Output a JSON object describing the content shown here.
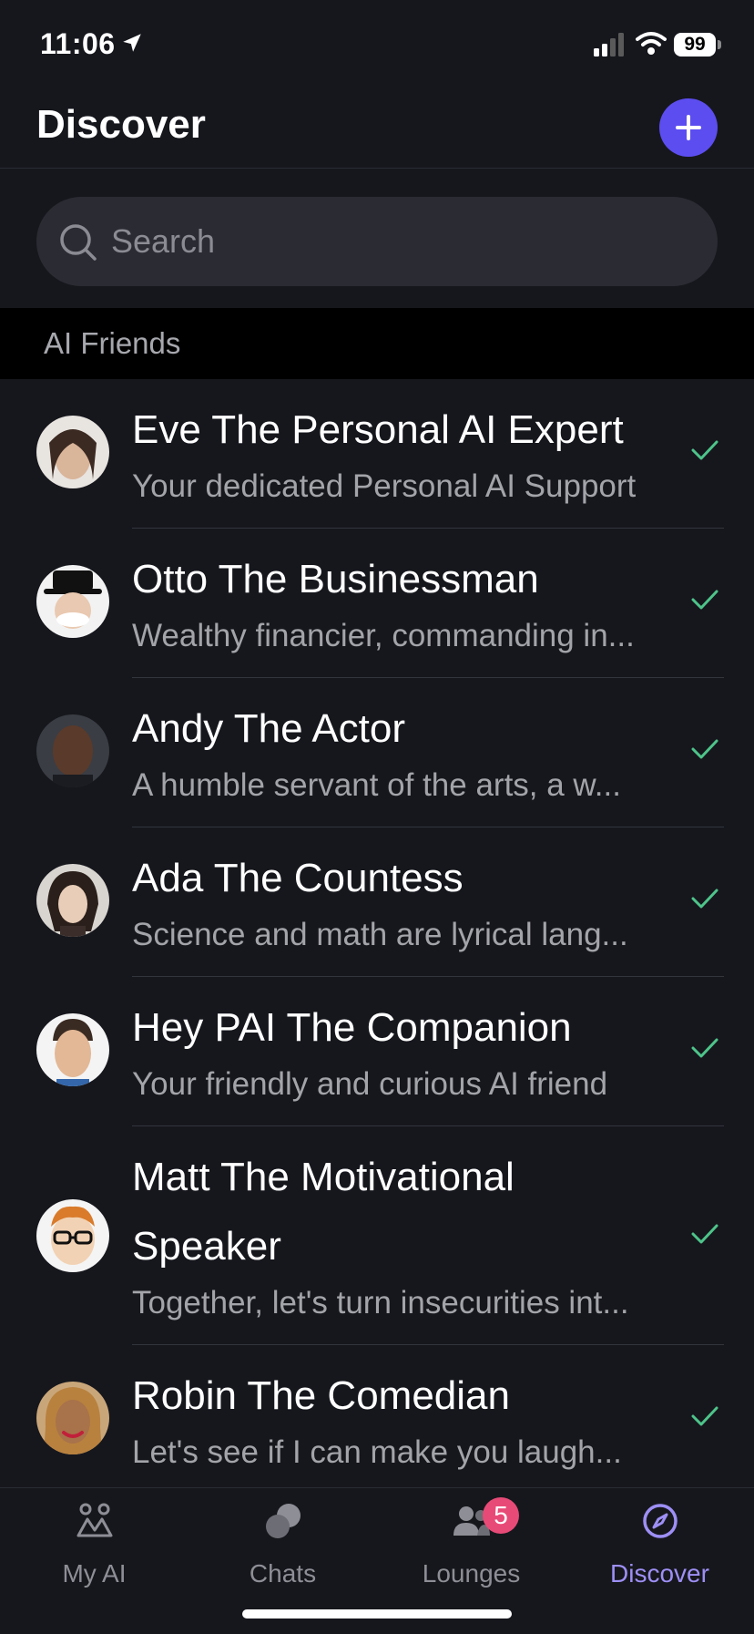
{
  "status_bar": {
    "time": "11:06",
    "battery": "99"
  },
  "header": {
    "title": "Discover",
    "add_icon": "plus-icon"
  },
  "search": {
    "placeholder": "Search",
    "value": ""
  },
  "section": {
    "title": "AI Friends"
  },
  "friends": [
    {
      "name": "Eve The Personal AI Expert",
      "description": "Your dedicated Personal AI Support",
      "added": true
    },
    {
      "name": "Otto The Businessman",
      "description": "Wealthy financier, commanding in...",
      "added": true
    },
    {
      "name": "Andy The Actor",
      "description": "A humble servant of the arts, a w...",
      "added": true
    },
    {
      "name": "Ada The Countess",
      "description": "Science and math are lyrical lang...",
      "added": true
    },
    {
      "name": "Hey PAI The Companion",
      "description": "Your friendly and curious AI friend",
      "added": true
    },
    {
      "name": "Matt The Motivational Speaker",
      "description": "Together, let's turn insecurities int...",
      "added": true
    },
    {
      "name": "Robin The Comedian",
      "description": "Let's see if I can make you laugh...",
      "added": true
    }
  ],
  "tabs": [
    {
      "label": "My AI",
      "icon": "my-ai-icon",
      "active": false
    },
    {
      "label": "Chats",
      "icon": "chats-icon",
      "active": false
    },
    {
      "label": "Lounges",
      "icon": "lounges-icon",
      "active": false,
      "badge": "5"
    },
    {
      "label": "Discover",
      "icon": "compass-icon",
      "active": true
    }
  ],
  "colors": {
    "accent": "#5c4df0",
    "active_tab": "#9d8ff5",
    "check": "#4ec48a",
    "badge": "#e84a77",
    "background": "#16171d"
  }
}
